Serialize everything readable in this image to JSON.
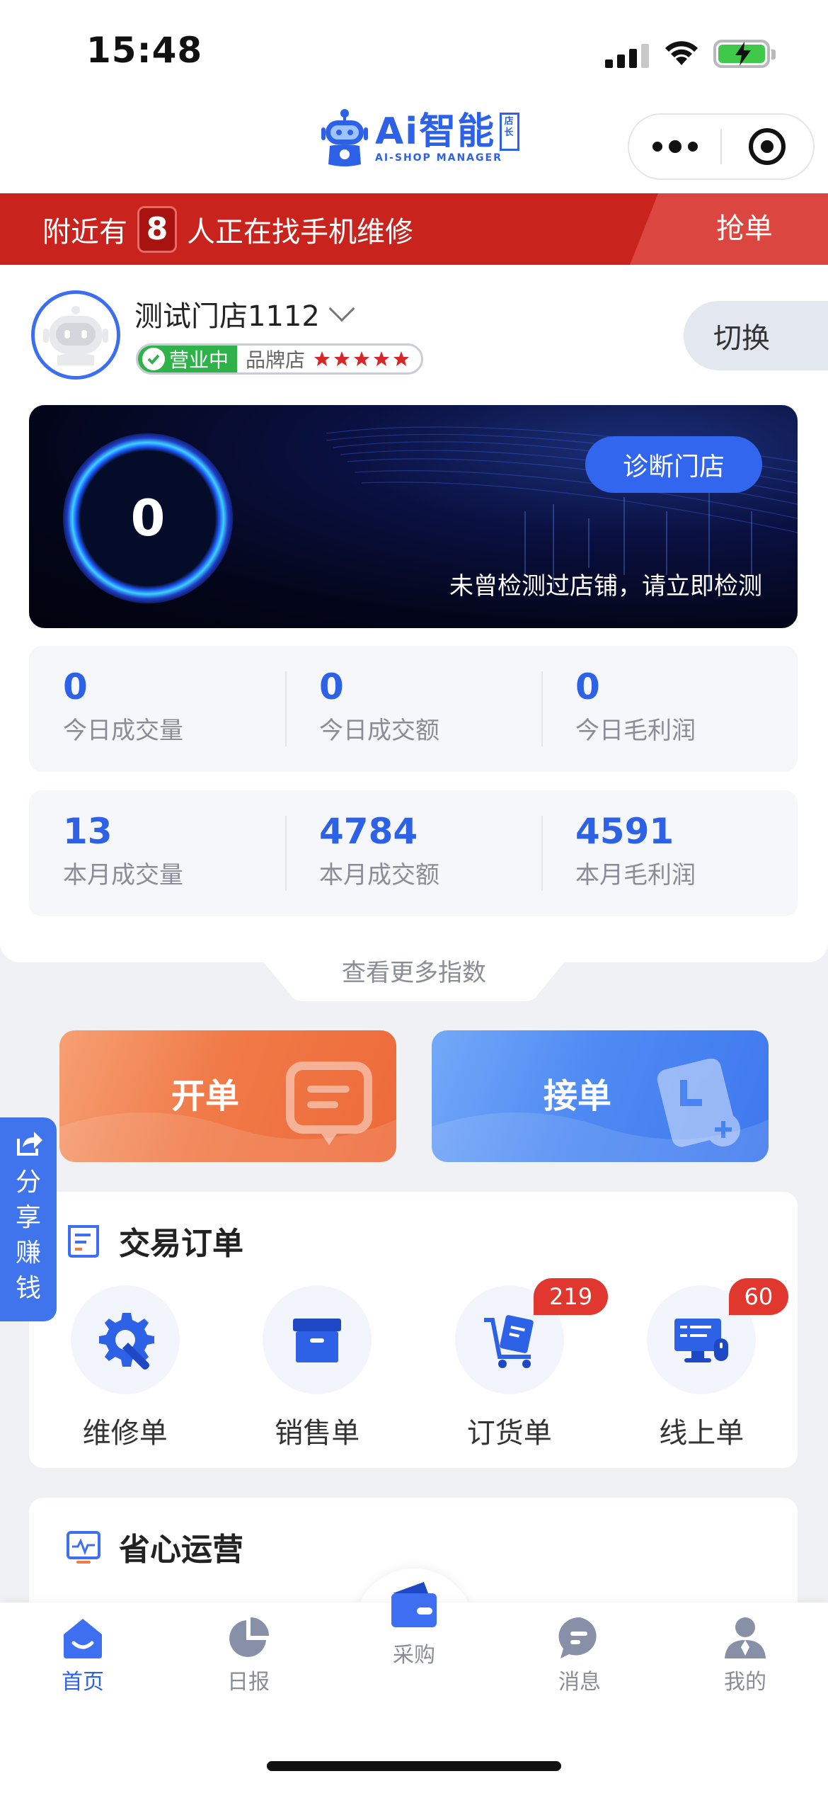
{
  "status_bar": {
    "time": "15:48"
  },
  "header": {
    "logo_text": "Ai智能",
    "logo_seal": "店长",
    "logo_subtitle": "AI-SHOP MANAGER"
  },
  "banner": {
    "prefix": "附近有",
    "count": "8",
    "suffix": "人正在找手机维修",
    "action": "抢单"
  },
  "store": {
    "name": "测试门店1112",
    "status": "营业中",
    "type": "品牌店",
    "rating": 5,
    "switch_label": "切换"
  },
  "diagnose": {
    "score": "0",
    "button": "诊断门店",
    "hint": "未曾检测过店铺，请立即检测"
  },
  "stats_today": [
    {
      "value": "0",
      "label": "今日成交量"
    },
    {
      "value": "0",
      "label": "今日成交额"
    },
    {
      "value": "0",
      "label": "今日毛利润"
    }
  ],
  "stats_month": [
    {
      "value": "13",
      "label": "本月成交量"
    },
    {
      "value": "4784",
      "label": "本月成交额"
    },
    {
      "value": "4591",
      "label": "本月毛利润"
    }
  ],
  "more_metrics": "查看更多指数",
  "actions": {
    "open_order": "开单",
    "take_order": "接单"
  },
  "orders": {
    "title": "交易订单",
    "items": [
      {
        "label": "维修单",
        "badge": ""
      },
      {
        "label": "销售单",
        "badge": ""
      },
      {
        "label": "订货单",
        "badge": "219"
      },
      {
        "label": "线上单",
        "badge": "60"
      }
    ]
  },
  "operations": {
    "title": "省心运营"
  },
  "share_float": {
    "chars": [
      "分",
      "享",
      "赚",
      "钱"
    ]
  },
  "tabbar": {
    "items": [
      {
        "label": "首页",
        "icon": "home-icon"
      },
      {
        "label": "日报",
        "icon": "pie-chart-icon"
      },
      {
        "label": "采购",
        "icon": "wallet-icon"
      },
      {
        "label": "消息",
        "icon": "chat-icon"
      },
      {
        "label": "我的",
        "icon": "user-icon"
      }
    ]
  },
  "colors": {
    "brand_blue": "#2e62e6",
    "banner_red": "#c9231e",
    "open_green": "#2fb24a",
    "badge_red": "#e0372f"
  }
}
